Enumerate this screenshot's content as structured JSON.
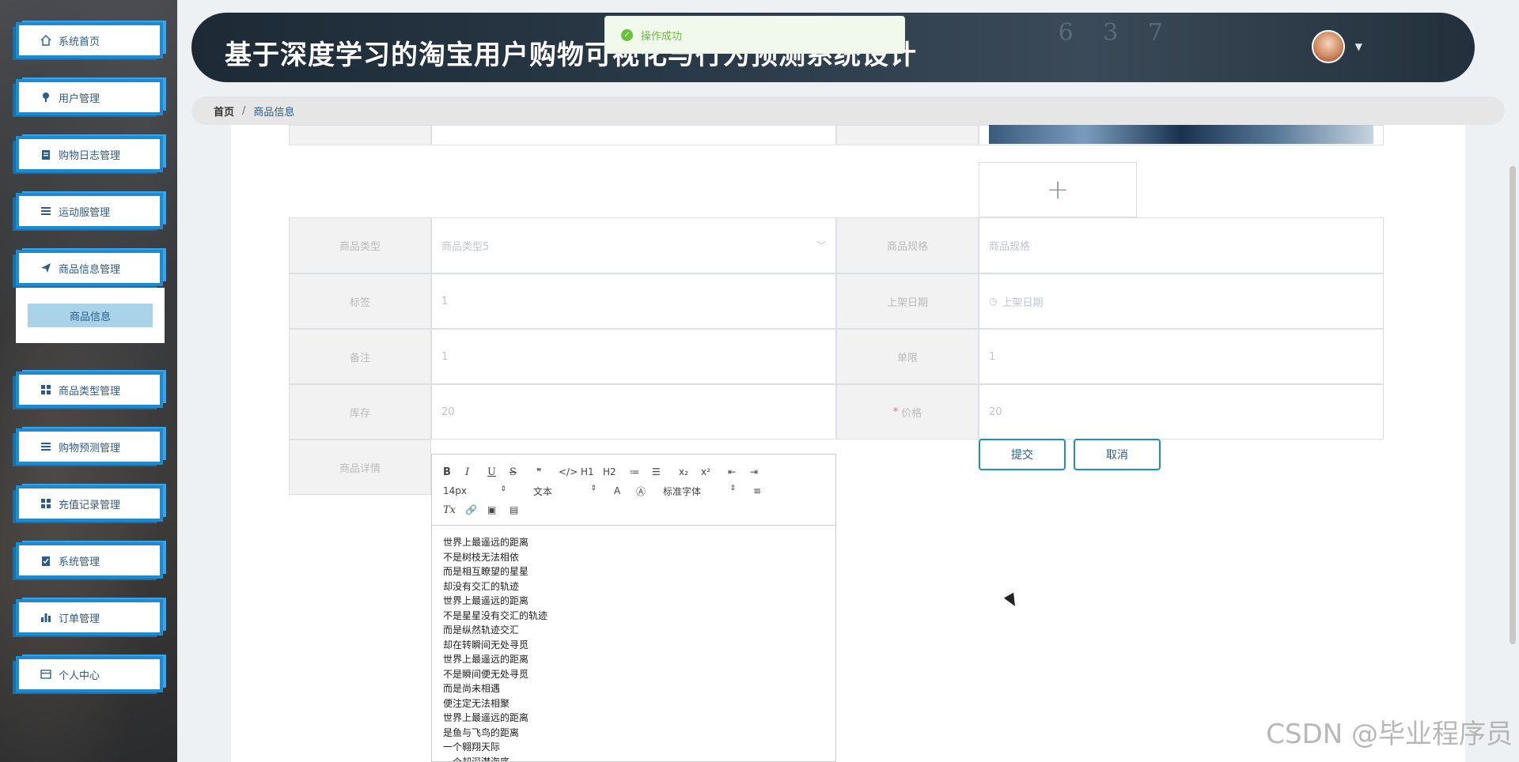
{
  "app": {
    "title": "基于深度学习的淘宝用户购物可视化与行为预测系统设计",
    "header_deco": "6 3 7"
  },
  "toast": {
    "message": "操作成功"
  },
  "breadcrumb": {
    "home": "首页",
    "separator": "/",
    "current": "商品信息"
  },
  "sidebar": {
    "items": [
      {
        "label": "系统首页",
        "icon": "home-icon"
      },
      {
        "label": "用户管理",
        "icon": "user-icon"
      },
      {
        "label": "购物日志管理",
        "icon": "clipboard-icon"
      },
      {
        "label": "运动服管理",
        "icon": "list-icon"
      },
      {
        "label": "商品信息管理",
        "icon": "send-icon"
      },
      {
        "label": "商品类型管理",
        "icon": "grid-icon"
      },
      {
        "label": "购物预测管理",
        "icon": "menu-icon"
      },
      {
        "label": "充值记录管理",
        "icon": "grid-icon"
      },
      {
        "label": "系统管理",
        "icon": "check-clipboard-icon"
      },
      {
        "label": "订单管理",
        "icon": "bar-chart-icon"
      },
      {
        "label": "个人中心",
        "icon": "card-icon"
      }
    ],
    "submenu": {
      "label": "商品信息"
    }
  },
  "form": {
    "fields": [
      {
        "label": "商品类型",
        "value": "商品类型5",
        "type": "select"
      },
      {
        "label": "商品规格",
        "value": "商品规格",
        "type": "placeholder"
      },
      {
        "label": "标签",
        "value": "1"
      },
      {
        "label": "上架日期",
        "value": "上架日期",
        "type": "date"
      },
      {
        "label": "备注",
        "value": "1"
      },
      {
        "label": "单限",
        "value": "1"
      },
      {
        "label": "库存",
        "value": "20"
      },
      {
        "label": "价格",
        "value": "20",
        "required_mark": "*"
      },
      {
        "label": "商品详情"
      }
    ],
    "submit_label": "提交",
    "cancel_label": "取消",
    "upload_symbol": "+"
  },
  "editor": {
    "toolbar_row1": [
      "B",
      "I",
      "U",
      "S",
      "❞",
      "</>",
      "H1",
      "H2",
      "≔",
      "☰",
      "x₂",
      "x²",
      "⇤",
      "⇥"
    ],
    "font_size": "14px",
    "paragraph": "文本",
    "font_family": "标准字体",
    "content_lines": [
      "世界上最遥远的距离",
      "不是树枝无法相依",
      "而是相互瞭望的星星",
      "却没有交汇的轨迹",
      "世界上最遥远的距离",
      "不是星星没有交汇的轨迹",
      "而是纵然轨迹交汇",
      "却在转瞬间无处寻觅",
      "世界上最遥远的距离",
      "不是瞬间便无处寻觅",
      "而是尚未相遇",
      "便注定无法相聚",
      "世界上最遥远的距离",
      "是鱼与飞鸟的距离",
      "一个翱翔天际",
      "一个却深潜海底"
    ]
  },
  "watermark": "CSDN @毕业程序员"
}
